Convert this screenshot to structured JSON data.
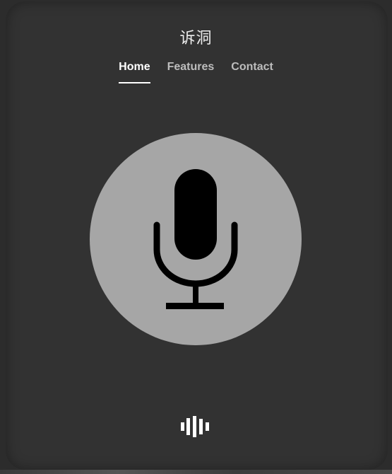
{
  "app": {
    "title": "诉洞"
  },
  "nav": {
    "items": [
      {
        "label": "Home",
        "active": true
      },
      {
        "label": "Features",
        "active": false
      },
      {
        "label": "Contact",
        "active": false
      }
    ]
  },
  "main": {
    "record_button_icon": "microphone-icon",
    "voice_indicator_icon": "sound-wave-icon"
  },
  "colors": {
    "background": "#2c2c2c",
    "panel": "#323232",
    "mic_circle": "#a6a6a6",
    "mic_icon": "#000000",
    "nav_active": "#ffffff",
    "nav_inactive": "#bdbdbd"
  }
}
